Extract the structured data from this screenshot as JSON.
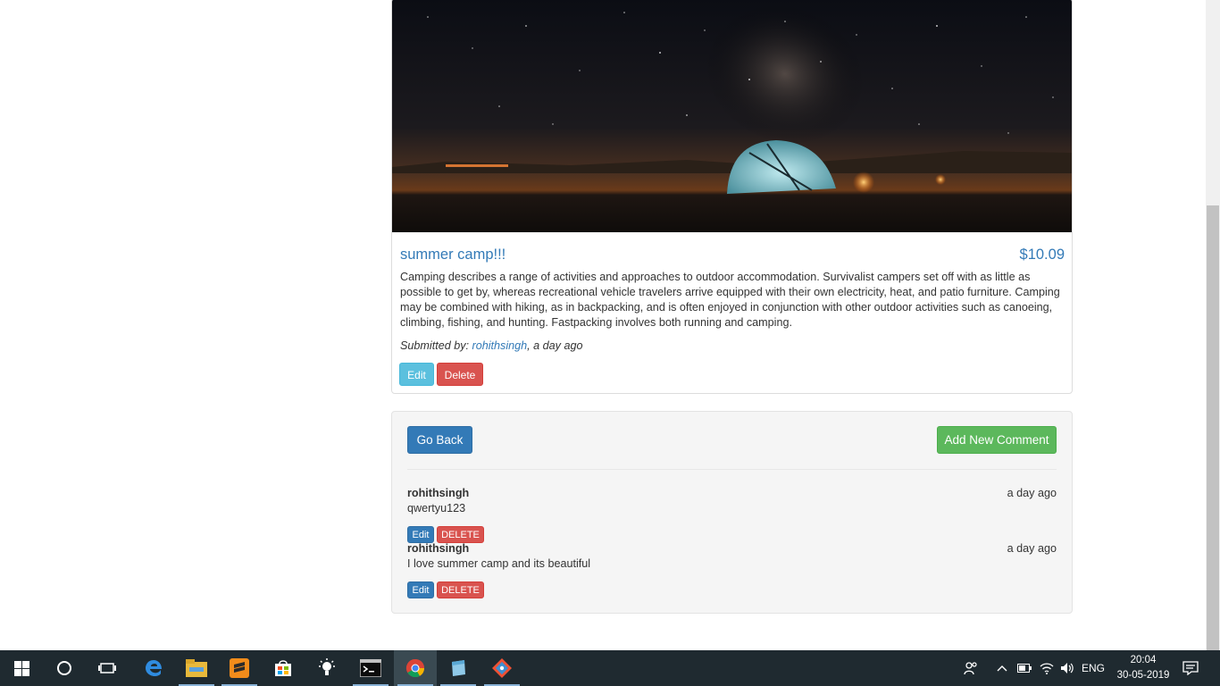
{
  "campground": {
    "name": "summer camp!!!",
    "price": "$10.09",
    "description": "Camping describes a range of activities and approaches to outdoor accommodation. Survivalist campers set off with as little as possible to get by, whereas recreational vehicle travelers arrive equipped with their own electricity, heat, and patio furniture. Camping may be combined with hiking, as in backpacking, and is often enjoyed in conjunction with other outdoor activities such as canoeing, climbing, fishing, and hunting. Fastpacking involves both running and camping.",
    "submitted_prefix": "Submitted by: ",
    "author": "rohithsingh",
    "submitted_suffix": ", a day ago",
    "edit_label": "Edit",
    "delete_label": "Delete"
  },
  "comments_section": {
    "back_label": "Go Back",
    "add_label": "Add New Comment",
    "comments": [
      {
        "author": "rohithsingh",
        "time": "a day ago",
        "text": "qwertyu123",
        "edit_label": "Edit",
        "delete_label": "DELETE"
      },
      {
        "author": "rohithsingh",
        "time": "a day ago",
        "text": "I love summer camp and its beautiful",
        "edit_label": "Edit",
        "delete_label": "DELETE"
      }
    ]
  },
  "taskbar": {
    "apps": [
      "windows-start-icon",
      "cortana-icon",
      "task-view-icon",
      "edge-icon",
      "file-explorer-icon",
      "sublime-text-icon",
      "store-icon",
      "light-bulb-icon",
      "terminal-icon",
      "chrome-icon",
      "notepad-icon",
      "git-icon"
    ],
    "language": "ENG",
    "time": "20:04",
    "date": "30-05-2019"
  },
  "colors": {
    "link": "#337ab7",
    "info": "#5bc0de",
    "danger": "#d9534f",
    "success": "#5cb85c",
    "primary": "#337ab7"
  }
}
